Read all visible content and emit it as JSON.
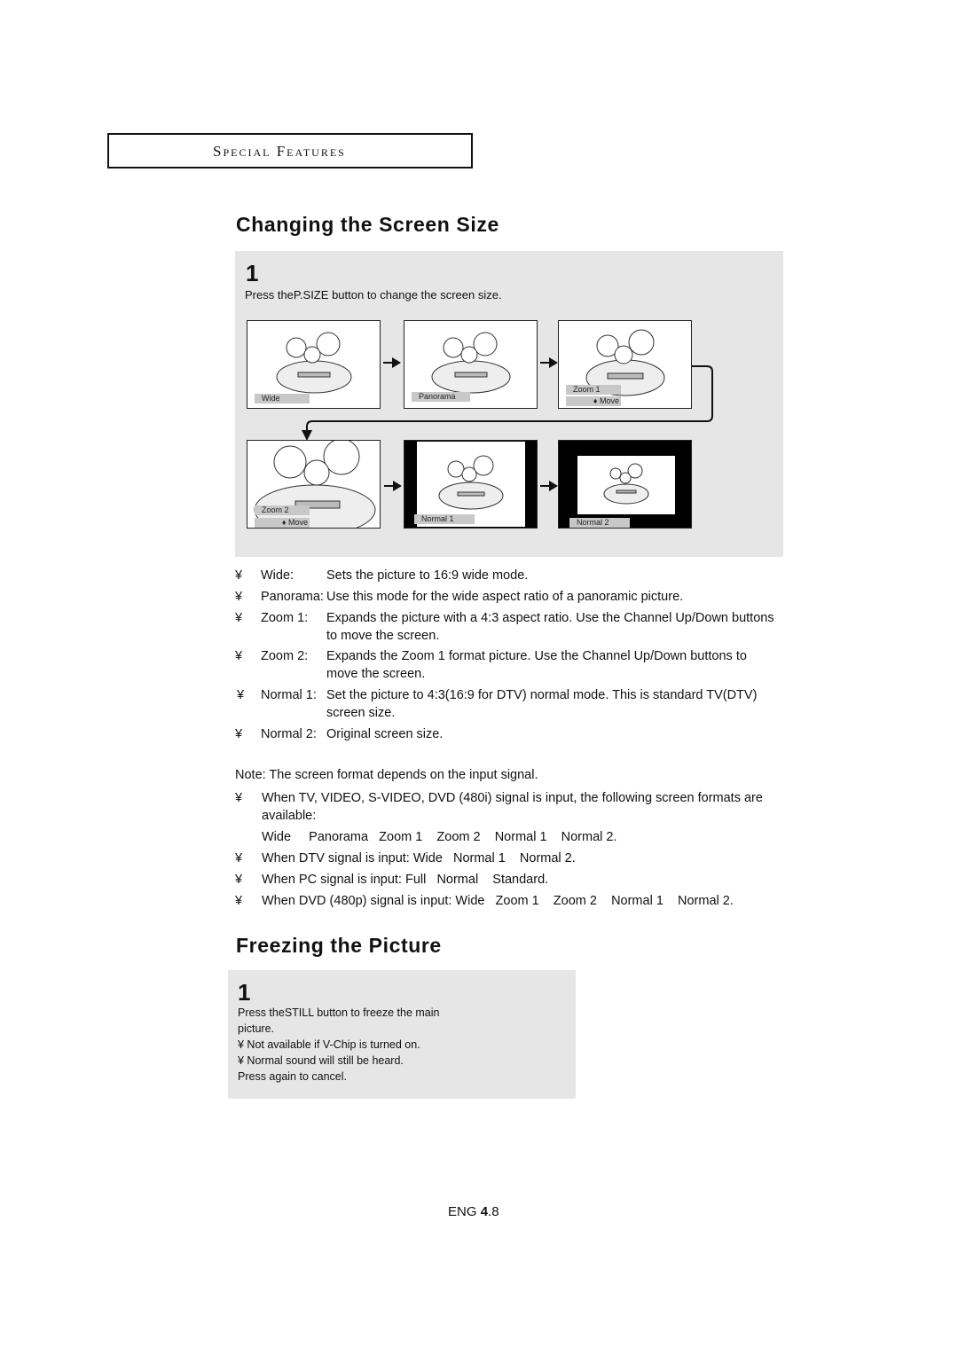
{
  "header": {
    "section": "Special Features"
  },
  "screen_size": {
    "title": "Changing the Screen Size",
    "step": {
      "number": "1",
      "text_pre": "Press the",
      "button": "P.SIZE",
      "text_post": "button to change the screen size."
    },
    "thumbnails": [
      {
        "label": "Wide",
        "sub": ""
      },
      {
        "label": "Panorama",
        "sub": ""
      },
      {
        "label": "Zoom  1",
        "sub": "♦ Move"
      },
      {
        "label": "Zoom  2",
        "sub": "♦ Move"
      },
      {
        "label": "Normal  1",
        "sub": ""
      },
      {
        "label": "Normal  2",
        "sub": ""
      }
    ],
    "modes": [
      {
        "bullet": "¥",
        "label": "Wide:",
        "desc": "Sets the picture to 16:9 wide mode.",
        "desc2": ""
      },
      {
        "bullet": "¥",
        "label": "Panorama:",
        "desc": "Use this mode for the wide aspect ratio of a panoramic picture.",
        "desc2": ""
      },
      {
        "bullet": "¥",
        "label": "Zoom 1:",
        "desc": "Expands the picture with a 4:3 aspect ratio. Use the Channel Up/Down buttons",
        "desc2": "to move the screen."
      },
      {
        "bullet": "¥",
        "label": "Zoom 2:",
        "desc": "Expands the Zoom 1 format picture. Use the Channel Up/Down buttons to",
        "desc2": "move the screen."
      },
      {
        "bullet": "¥",
        "label": "Normal 1:",
        "desc": "Set the picture to 4:3(16:9 for DTV) normal mode. This is standard TV(DTV)",
        "desc2": "screen size."
      },
      {
        "bullet": "¥",
        "label": "Normal 2:",
        "desc": "Original screen size.",
        "desc2": ""
      }
    ],
    "note": "Note: The screen format depends on the input signal.",
    "signals": [
      {
        "bullet": "¥",
        "text": "When TV, VIDEO, S-VIDEO, DVD (480i) signal is input, the following screen formats are",
        "text2": "available:",
        "text3": "Wide     Panorama   Zoom 1    Zoom 2    Normal 1    Normal 2."
      },
      {
        "bullet": "¥",
        "text": "When DTV signal is input: Wide   Normal 1    Normal 2."
      },
      {
        "bullet": "¥",
        "text": "When PC signal is input: Full   Normal    Standard."
      },
      {
        "bullet": "¥",
        "text": "When DVD (480p) signal is input: Wide   Zoom 1    Zoom 2    Normal 1    Normal 2."
      }
    ]
  },
  "freeze": {
    "title": "Freezing the Picture",
    "step": {
      "number": "1",
      "text_pre": "Press the",
      "button": "STILL",
      "text_post": "button to freeze the main",
      "text_line2": "picture.",
      "notes": [
        "¥ Not available if V-Chip is turned on.",
        "¥ Normal sound will still be heard."
      ],
      "cancel": "Press again to cancel."
    }
  },
  "footer": {
    "lang": "ENG",
    "page": "4",
    "sub": ".8"
  }
}
